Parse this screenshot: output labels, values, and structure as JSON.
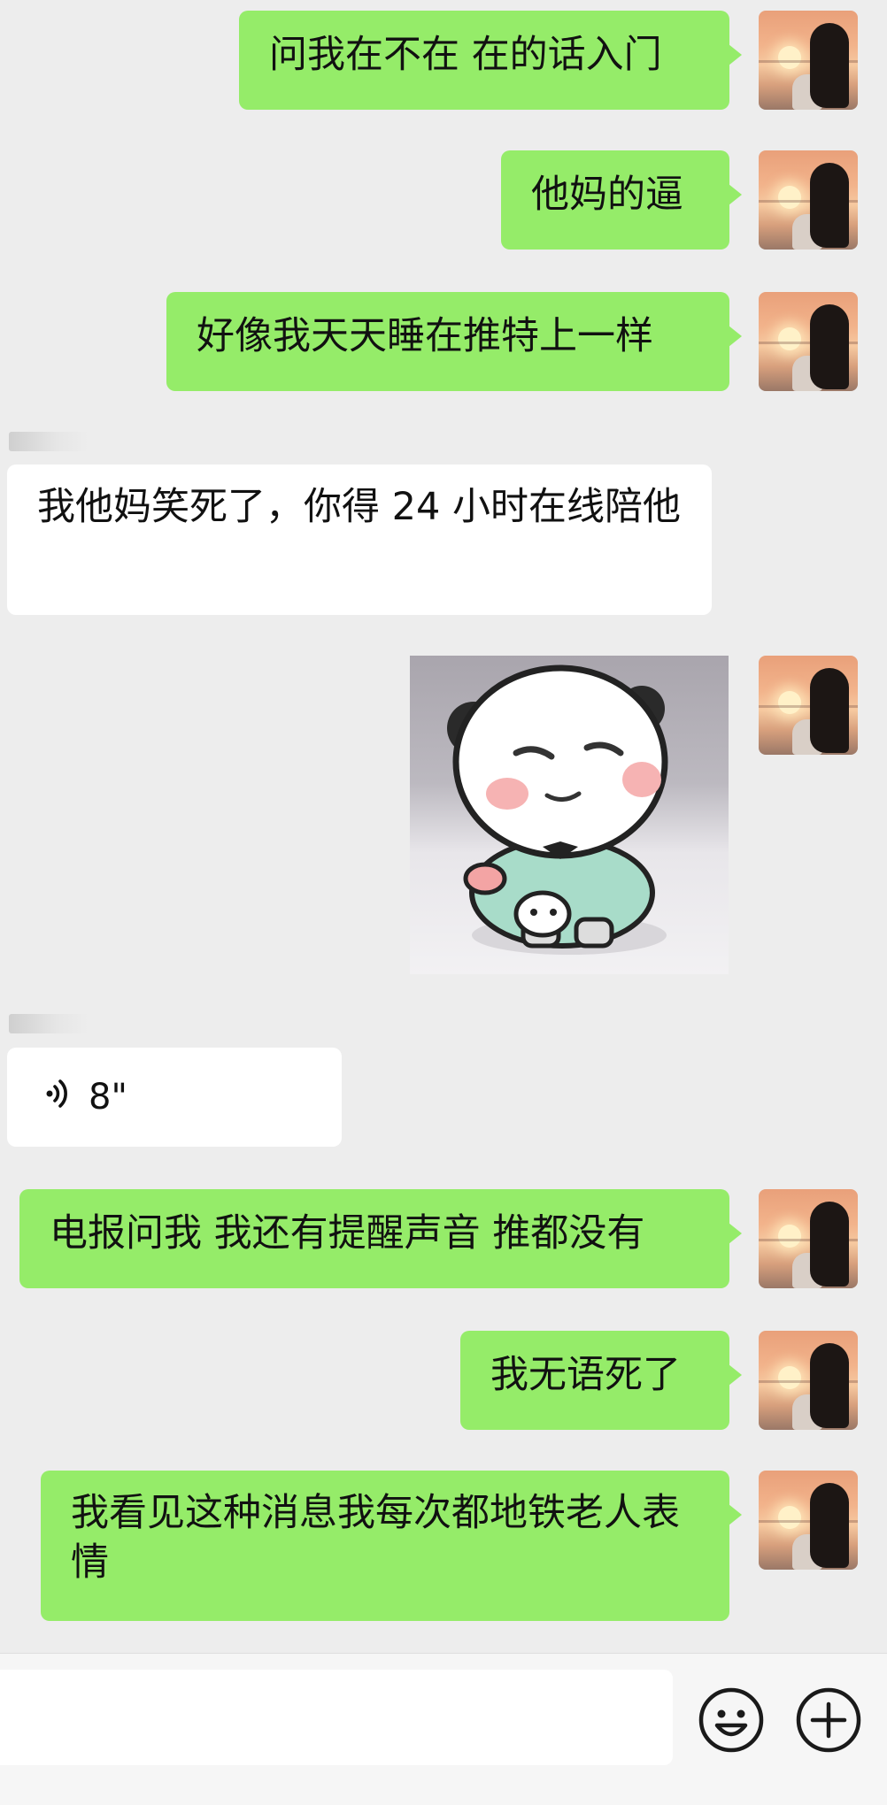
{
  "conversation": {
    "messages": [
      {
        "side": "me",
        "type": "text",
        "text": "问我在不在 在的话入门"
      },
      {
        "side": "me",
        "type": "text",
        "text": "他妈的逼"
      },
      {
        "side": "me",
        "type": "text",
        "text": "好像我天天睡在推特上一样"
      },
      {
        "side": "other",
        "type": "text",
        "text": "我他妈笑死了，你得 24 小时在线陪他"
      },
      {
        "side": "me",
        "type": "sticker",
        "sticker": "panda-meme-sticker"
      },
      {
        "side": "other",
        "type": "voice",
        "duration": "8\""
      },
      {
        "side": "me",
        "type": "text",
        "text": "电报问我 我还有提醒声音 推都没有"
      },
      {
        "side": "me",
        "type": "text",
        "text": "我无语死了"
      },
      {
        "side": "me",
        "type": "text",
        "text": "我看见这种消息我每次都地铁老人表情"
      }
    ]
  },
  "colors": {
    "background": "#ededed",
    "my_bubble": "#95ec69",
    "other_bubble": "#ffffff",
    "input_bar": "#f6f6f6"
  },
  "input_bar": {
    "icons": [
      "emoji-icon",
      "plus-icon"
    ]
  }
}
